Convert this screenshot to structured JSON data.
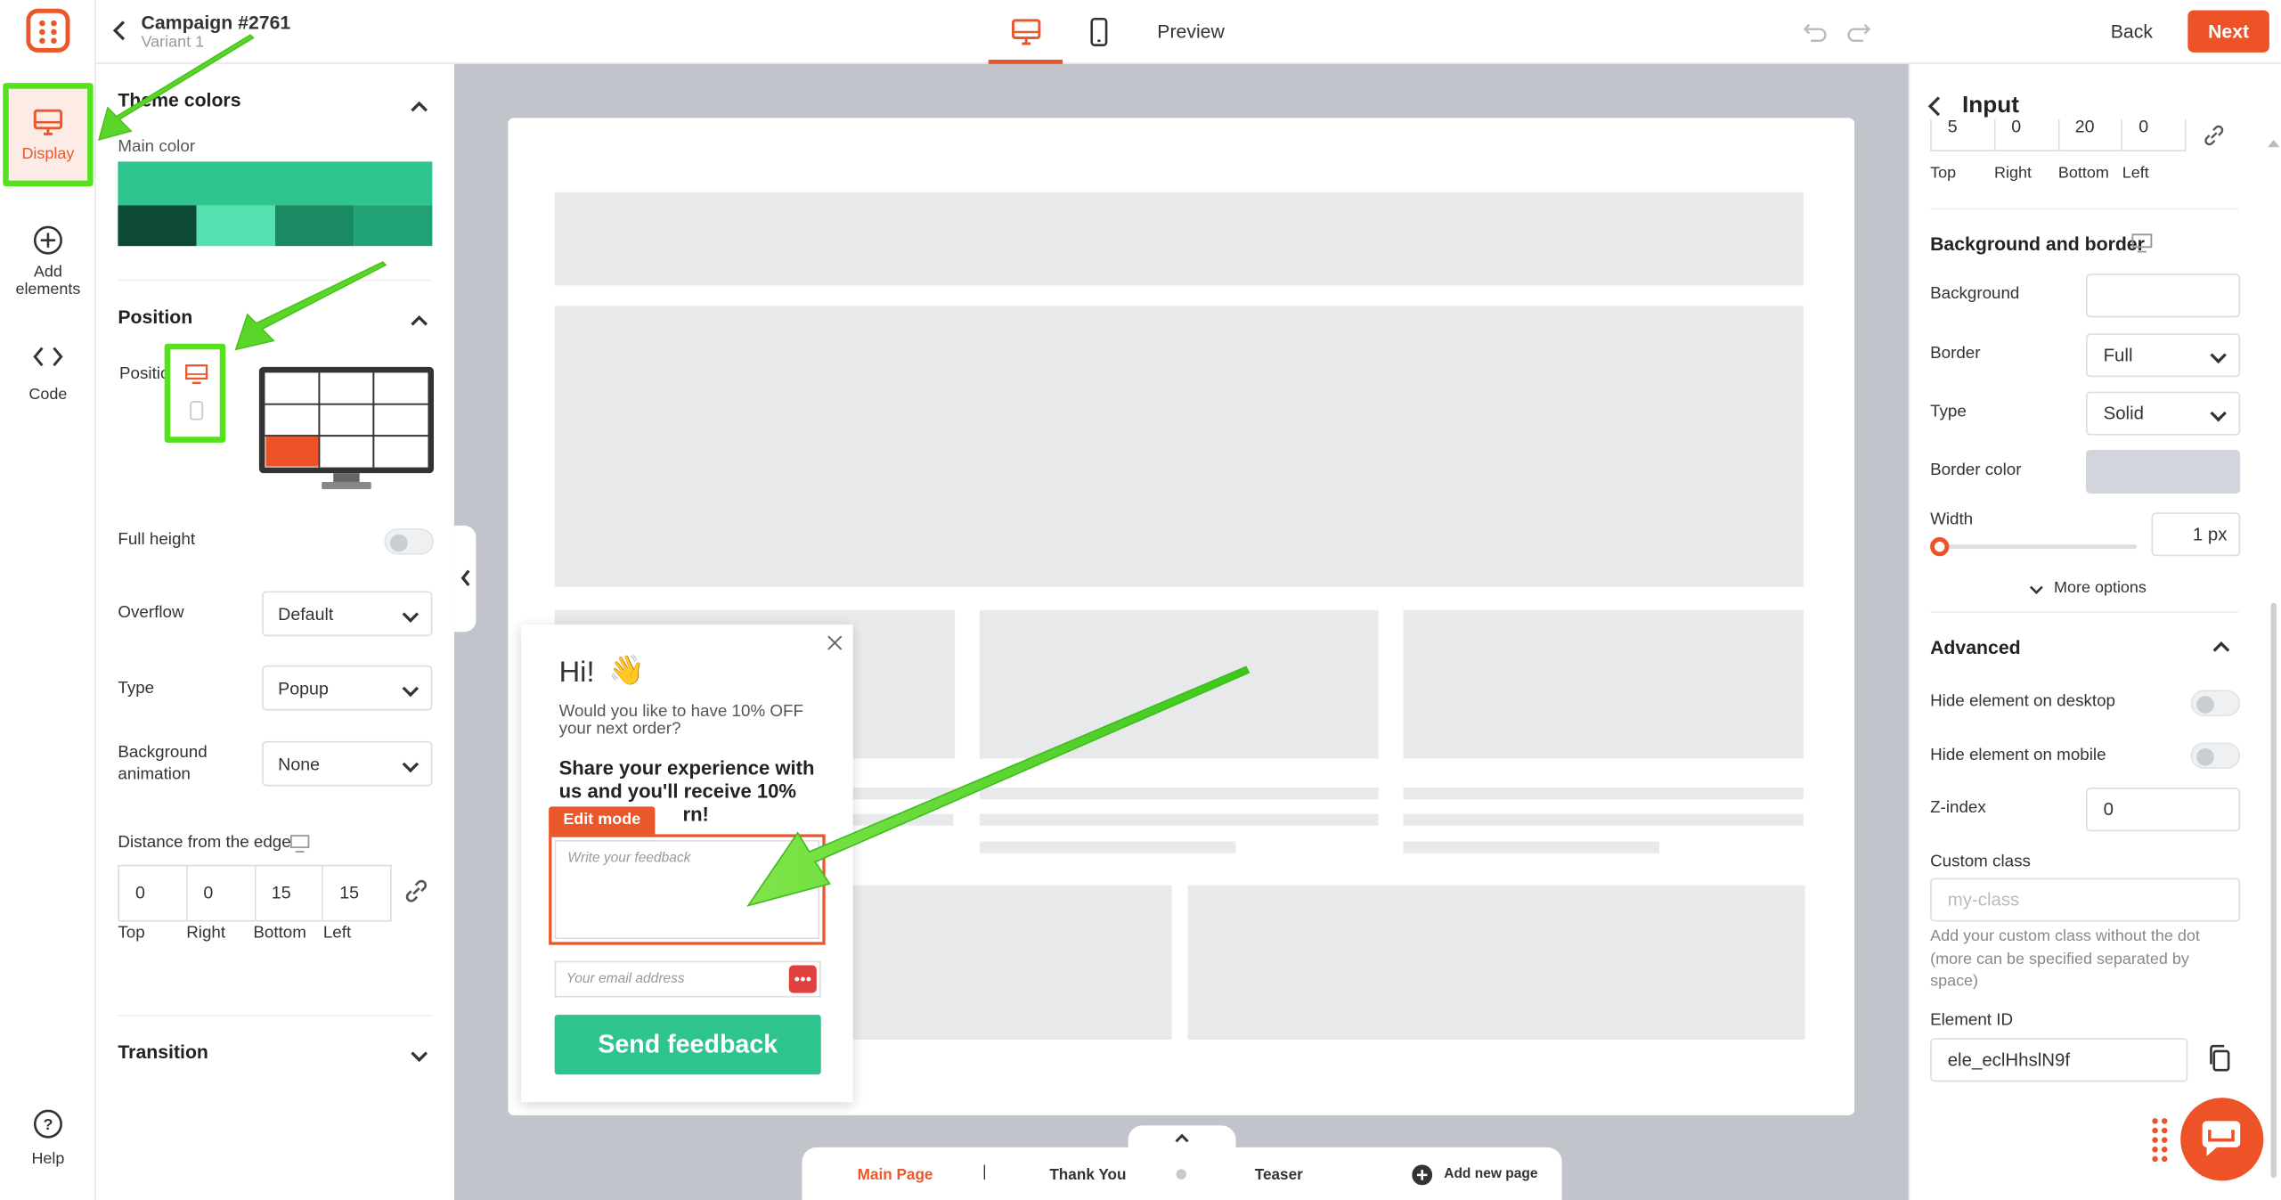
{
  "app": {
    "campaign_title": "Campaign #2761",
    "variant": "Variant 1",
    "preview_label": "Preview",
    "back_label": "Back",
    "next_label": "Next",
    "accent_color": "#e9572b"
  },
  "rail": {
    "display_label": "Display",
    "add_label_1": "Add",
    "add_label_2": "elements",
    "code_label": "Code",
    "help_label": "Help"
  },
  "left_panel": {
    "theme_colors": {
      "heading": "Theme colors",
      "main_color_label": "Main color",
      "main_color": "#2dc48d",
      "swatches": [
        "#0d4a36",
        "#55e0b0",
        "#1a8a62",
        "#21a275"
      ]
    },
    "position": {
      "heading": "Position",
      "position_label": "Position",
      "selected_cell": "bottom-left"
    },
    "full_height_label": "Full height",
    "full_height_on": false,
    "overflow_label": "Overflow",
    "overflow_value": "Default",
    "type_label": "Type",
    "type_value": "Popup",
    "bg_anim_label_1": "Background",
    "bg_anim_label_2": "animation",
    "bg_anim_value": "None",
    "distance_label": "Distance from the edge",
    "distance": {
      "top": "0",
      "right": "0",
      "bottom": "15",
      "left": "15",
      "top_label": "Top",
      "right_label": "Right",
      "bottom_label": "Bottom",
      "left_label": "Left"
    },
    "transition_heading": "Transition"
  },
  "popup": {
    "greeting": "Hi!",
    "wave_emoji": "👋",
    "offer_line_1": "Would you like to have 10% OFF",
    "offer_line_2": "your next order?",
    "bold_line_1": "Share your experience with",
    "bold_line_2": "us and you'll receive 10%",
    "bold_line_3": "rn!",
    "edit_mode_label": "Edit mode",
    "feedback_placeholder": "Write your feedback",
    "email_placeholder": "Your email address",
    "send_label": "Send feedback",
    "button_color": "#2dc48d"
  },
  "page_tabs": {
    "main": "Main Page",
    "separator": "|",
    "thank_you": "Thank You",
    "teaser": "Teaser",
    "add_page": "Add new page"
  },
  "right_panel": {
    "title": "Input",
    "padding": {
      "top": "5",
      "right": "0",
      "bottom": "20",
      "left": "0",
      "top_label": "Top",
      "right_label": "Right",
      "bottom_label": "Bottom",
      "left_label": "Left"
    },
    "bg_border_heading": "Background and border",
    "background_label": "Background",
    "border_label": "Border",
    "border_value": "Full",
    "type_label": "Type",
    "type_value": "Solid",
    "border_color_label": "Border color",
    "border_color": "#d2d6dc",
    "width_label": "Width",
    "width_value": "1",
    "width_unit": "px",
    "width_fraction": 0.0,
    "more_options": "More options",
    "advanced_heading": "Advanced",
    "hide_desktop_label": "Hide element on desktop",
    "hide_mobile_label": "Hide element on mobile",
    "zindex_label": "Z-index",
    "zindex_value": "0",
    "custom_class_label": "Custom class",
    "custom_class_placeholder": "my-class",
    "custom_class_hint_1": "Add your custom class without the dot",
    "custom_class_hint_2": "(more can be specified separated by",
    "custom_class_hint_3": "space)",
    "element_id_label": "Element ID",
    "element_id_value": "ele_eclHhslN9f"
  }
}
